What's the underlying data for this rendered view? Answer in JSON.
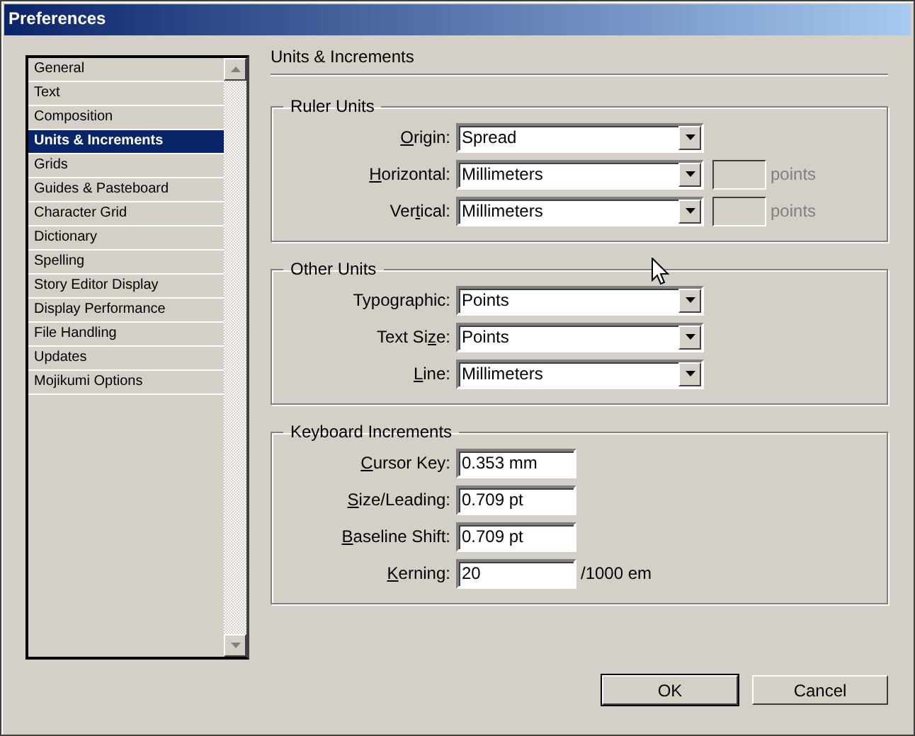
{
  "window": {
    "title": "Preferences"
  },
  "sidebar": {
    "items": [
      {
        "label": "General",
        "selected": false
      },
      {
        "label": "Text",
        "selected": false
      },
      {
        "label": "Composition",
        "selected": false
      },
      {
        "label": "Units & Increments",
        "selected": true
      },
      {
        "label": "Grids",
        "selected": false
      },
      {
        "label": "Guides & Pasteboard",
        "selected": false
      },
      {
        "label": "Character Grid",
        "selected": false
      },
      {
        "label": "Dictionary",
        "selected": false
      },
      {
        "label": "Spelling",
        "selected": false
      },
      {
        "label": "Story Editor Display",
        "selected": false
      },
      {
        "label": "Display Performance",
        "selected": false
      },
      {
        "label": "File Handling",
        "selected": false
      },
      {
        "label": "Updates",
        "selected": false
      },
      {
        "label": "Mojikumi Options",
        "selected": false
      }
    ]
  },
  "panel": {
    "title": "Units & Increments",
    "groups": [
      {
        "title": "Ruler Units",
        "rows": [
          {
            "kind": "dropdown",
            "label_parts": [
              {
                "text": "O",
                "underline": true
              },
              {
                "text": "rigin:",
                "underline": false
              }
            ],
            "value": "Spread"
          },
          {
            "kind": "dropdown",
            "label_parts": [
              {
                "text": "H",
                "underline": true
              },
              {
                "text": "orizontal:",
                "underline": false
              }
            ],
            "value": "Millimeters",
            "unit_field": {
              "disabled": true
            },
            "unit": "points"
          },
          {
            "kind": "dropdown",
            "label_parts": [
              {
                "text": "Ver",
                "underline": false
              },
              {
                "text": "t",
                "underline": true
              },
              {
                "text": "ical:",
                "underline": false
              }
            ],
            "value": "Millimeters",
            "unit_field": {
              "disabled": true
            },
            "unit": "points"
          }
        ]
      },
      {
        "title": "Other Units",
        "rows": [
          {
            "kind": "dropdown",
            "label_parts": [
              {
                "text": "Typo",
                "underline": false
              },
              {
                "text": "g",
                "underline": true
              },
              {
                "text": "raphic:",
                "underline": false
              }
            ],
            "value": "Points"
          },
          {
            "kind": "dropdown",
            "label_parts": [
              {
                "text": "Text Si",
                "underline": false
              },
              {
                "text": "z",
                "underline": true
              },
              {
                "text": "e:",
                "underline": false
              }
            ],
            "value": "Points"
          },
          {
            "kind": "dropdown",
            "label_parts": [
              {
                "text": "L",
                "underline": true
              },
              {
                "text": "ine:",
                "underline": false
              }
            ],
            "value": "Millimeters"
          }
        ]
      },
      {
        "title": "Keyboard Increments",
        "rows": [
          {
            "kind": "text",
            "label_parts": [
              {
                "text": "C",
                "underline": true
              },
              {
                "text": "ursor Key:",
                "underline": false
              }
            ],
            "value": "0.353 mm"
          },
          {
            "kind": "text",
            "label_parts": [
              {
                "text": "S",
                "underline": true
              },
              {
                "text": "ize/Leading:",
                "underline": false
              }
            ],
            "value": "0.709 pt"
          },
          {
            "kind": "text",
            "label_parts": [
              {
                "text": "B",
                "underline": true
              },
              {
                "text": "aseline Shift:",
                "underline": false
              }
            ],
            "value": "0.709 pt"
          },
          {
            "kind": "text",
            "label_parts": [
              {
                "text": "K",
                "underline": true
              },
              {
                "text": "erning:",
                "underline": false
              }
            ],
            "value": "20",
            "unit": "/1000 em"
          }
        ]
      }
    ]
  },
  "buttons": [
    {
      "label": "OK",
      "default": true
    },
    {
      "label": "Cancel",
      "default": false
    }
  ]
}
